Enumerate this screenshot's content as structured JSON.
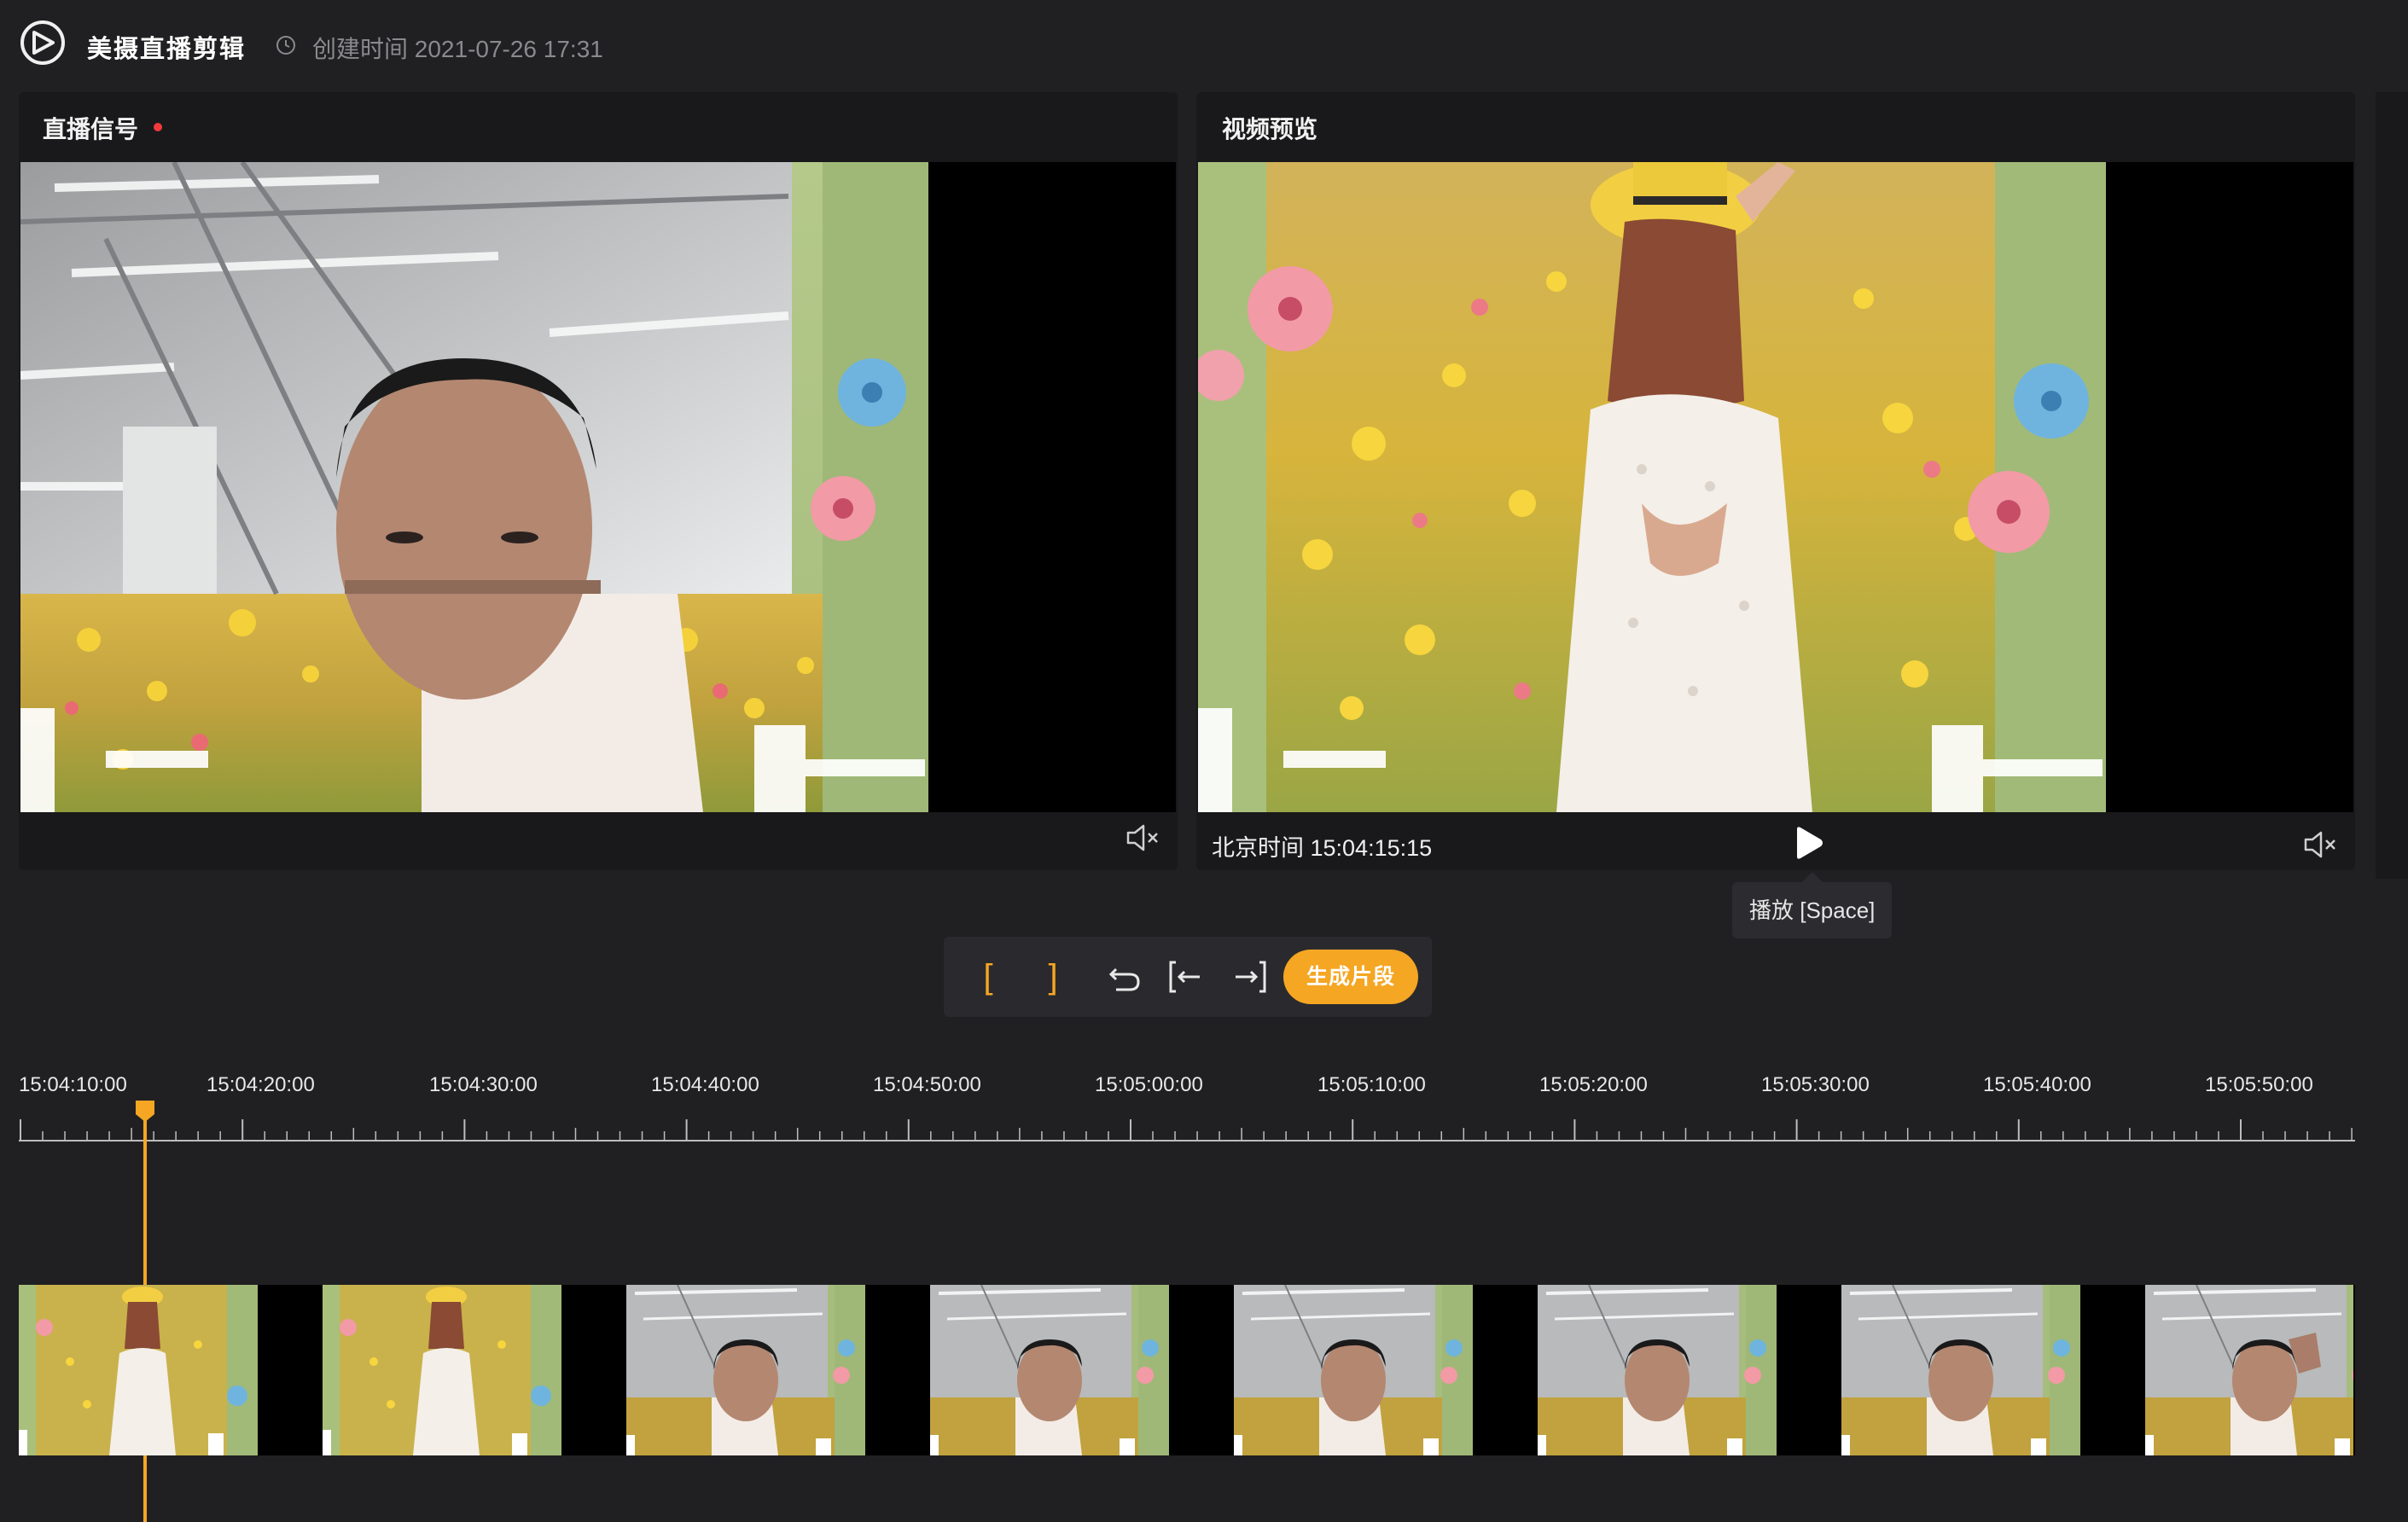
{
  "app": {
    "title": "美摄直播剪辑",
    "created_label": "创建时间 2021-07-26 17:31",
    "logo_icon": "logo-icon",
    "clock_icon": "clock-icon"
  },
  "live_panel": {
    "title": "直播信号",
    "live_indicator_color": "#f23a3a",
    "mute_icon": "volume-mute-icon"
  },
  "preview_panel": {
    "title": "视频预览",
    "time_label": "北京时间 15:04:15:15",
    "play_icon": "play-icon",
    "play_tooltip": "播放 [Space]",
    "mute_icon": "volume-mute-icon"
  },
  "toolbar": {
    "mark_in": "[",
    "mark_out": "]",
    "undo_icon": "undo-icon",
    "go_to_in_icon": "go-to-in-icon",
    "go_to_out_icon": "go-to-out-icon",
    "generate_label": "生成片段",
    "accent_color": "#f5a623"
  },
  "timeline": {
    "tick_labels": [
      "15:04:10:00",
      "15:04:20:00",
      "15:04:30:00",
      "15:04:40:00",
      "15:04:50:00",
      "15:05:00:00",
      "15:05:10:00",
      "15:05:20:00",
      "15:05:30:00",
      "15:05:40:00",
      "15:05:50:00"
    ],
    "playhead_time": "15:04:15:15",
    "thumbnails": [
      "flowers-girl",
      "flowers-girl",
      "presenter",
      "presenter",
      "presenter",
      "presenter",
      "presenter",
      "presenter-hand-on-head"
    ]
  }
}
